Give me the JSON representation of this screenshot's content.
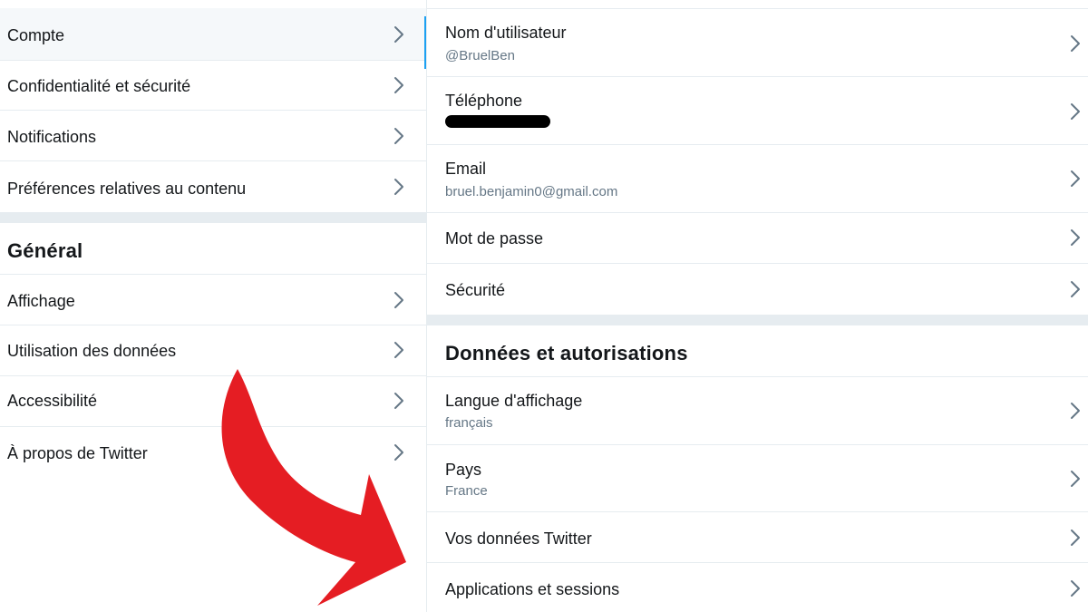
{
  "left_menu": {
    "items": [
      {
        "label": "Compte"
      },
      {
        "label": "Confidentialité et sécurité"
      },
      {
        "label": "Notifications"
      },
      {
        "label": "Préférences relatives au contenu"
      }
    ],
    "general": {
      "title": "Général",
      "items": [
        {
          "label": "Affichage"
        },
        {
          "label": "Utilisation des données"
        },
        {
          "label": "Accessibilité"
        },
        {
          "label": "À propos de Twitter"
        }
      ]
    }
  },
  "account": {
    "items": [
      {
        "label": "Nom d'utilisateur",
        "value": "@BruelBen"
      },
      {
        "label": "Téléphone"
      },
      {
        "label": "Email",
        "value": "bruel.benjamin0@gmail.com"
      },
      {
        "label": "Mot de passe"
      },
      {
        "label": "Sécurité"
      }
    ]
  },
  "data_permissions": {
    "title": "Données et autorisations",
    "items": [
      {
        "label": "Langue d'affichage",
        "value": "français"
      },
      {
        "label": "Pays",
        "value": "France"
      },
      {
        "label": "Vos données Twitter"
      },
      {
        "label": "Applications et sessions"
      }
    ]
  },
  "colors": {
    "accent": "#1da1f2",
    "divider": "#e6ecf0",
    "secondary_text": "#657786",
    "annotation_arrow": "#e51d23"
  },
  "icons": {
    "row_chevron": "chevron-right-icon",
    "annotation": "curved-arrow-icon"
  }
}
